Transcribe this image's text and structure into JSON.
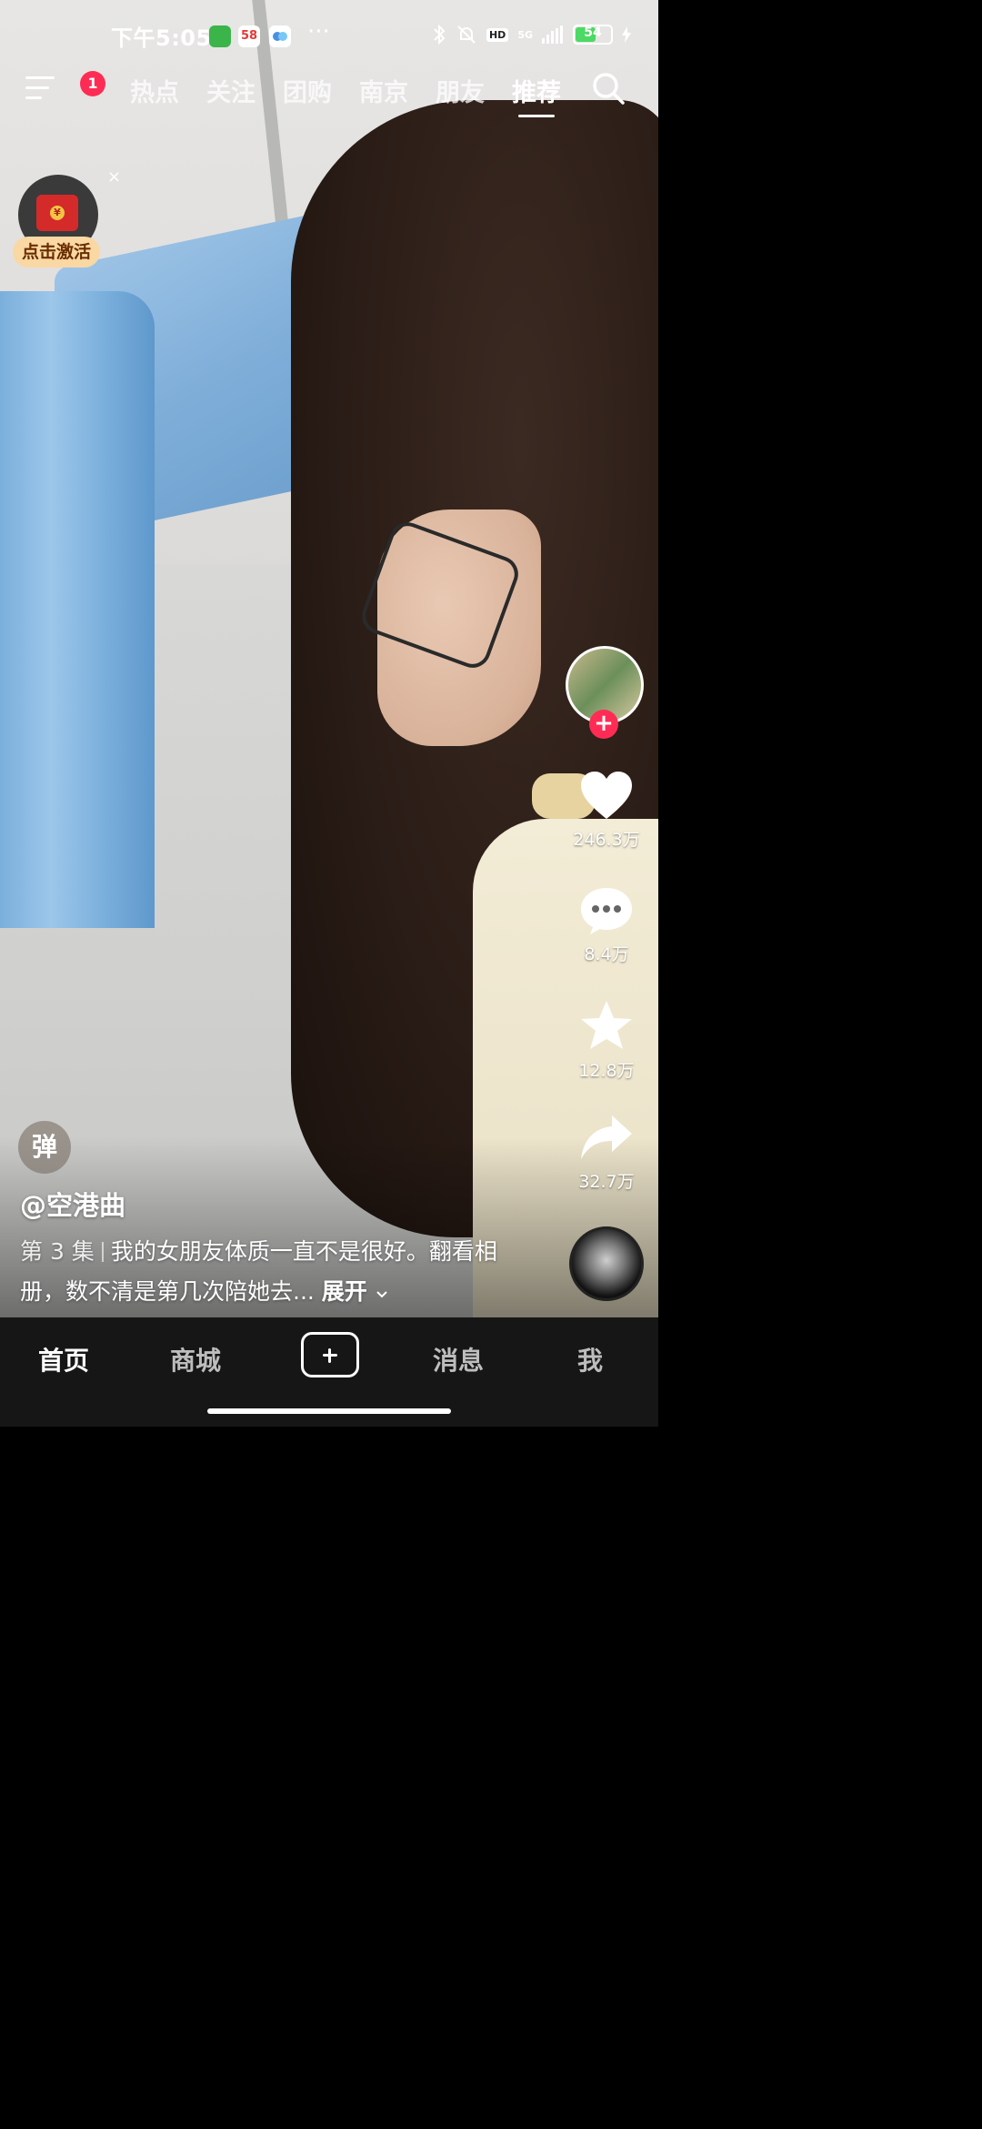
{
  "status_bar": {
    "time": "下午5:05",
    "network": "5G",
    "hd": "HD",
    "more": "···",
    "battery_level": 54,
    "battery_text": "54",
    "app_icon_58": "58"
  },
  "top_nav": {
    "notification_count": "1",
    "tabs": [
      {
        "label": "热点"
      },
      {
        "label": "关注"
      },
      {
        "label": "团购"
      },
      {
        "label": "南京"
      },
      {
        "label": "朋友"
      },
      {
        "label": "推荐"
      }
    ],
    "active_tab": "推荐"
  },
  "red_packet": {
    "label": "点击激活",
    "close": "×",
    "symbol": "¥"
  },
  "creator": {
    "follow_symbol": "+"
  },
  "actions": {
    "likes": "246.3万",
    "comments": "8.4万",
    "favorites": "12.8万",
    "shares": "32.7万"
  },
  "danmaku": {
    "label": "弹"
  },
  "caption": {
    "author": "@空港曲",
    "episode": "第 3 集",
    "text": "我的女朋友体质一直不是很好。翻看相册，数不清是第几次陪她去...",
    "expand": "展开"
  },
  "tabbar": {
    "home": "首页",
    "mall": "商城",
    "messages": "消息",
    "me": "我"
  },
  "colors": {
    "accent": "#fe2c55",
    "battery": "#4cd964",
    "tabbar_bg": "#161616"
  }
}
